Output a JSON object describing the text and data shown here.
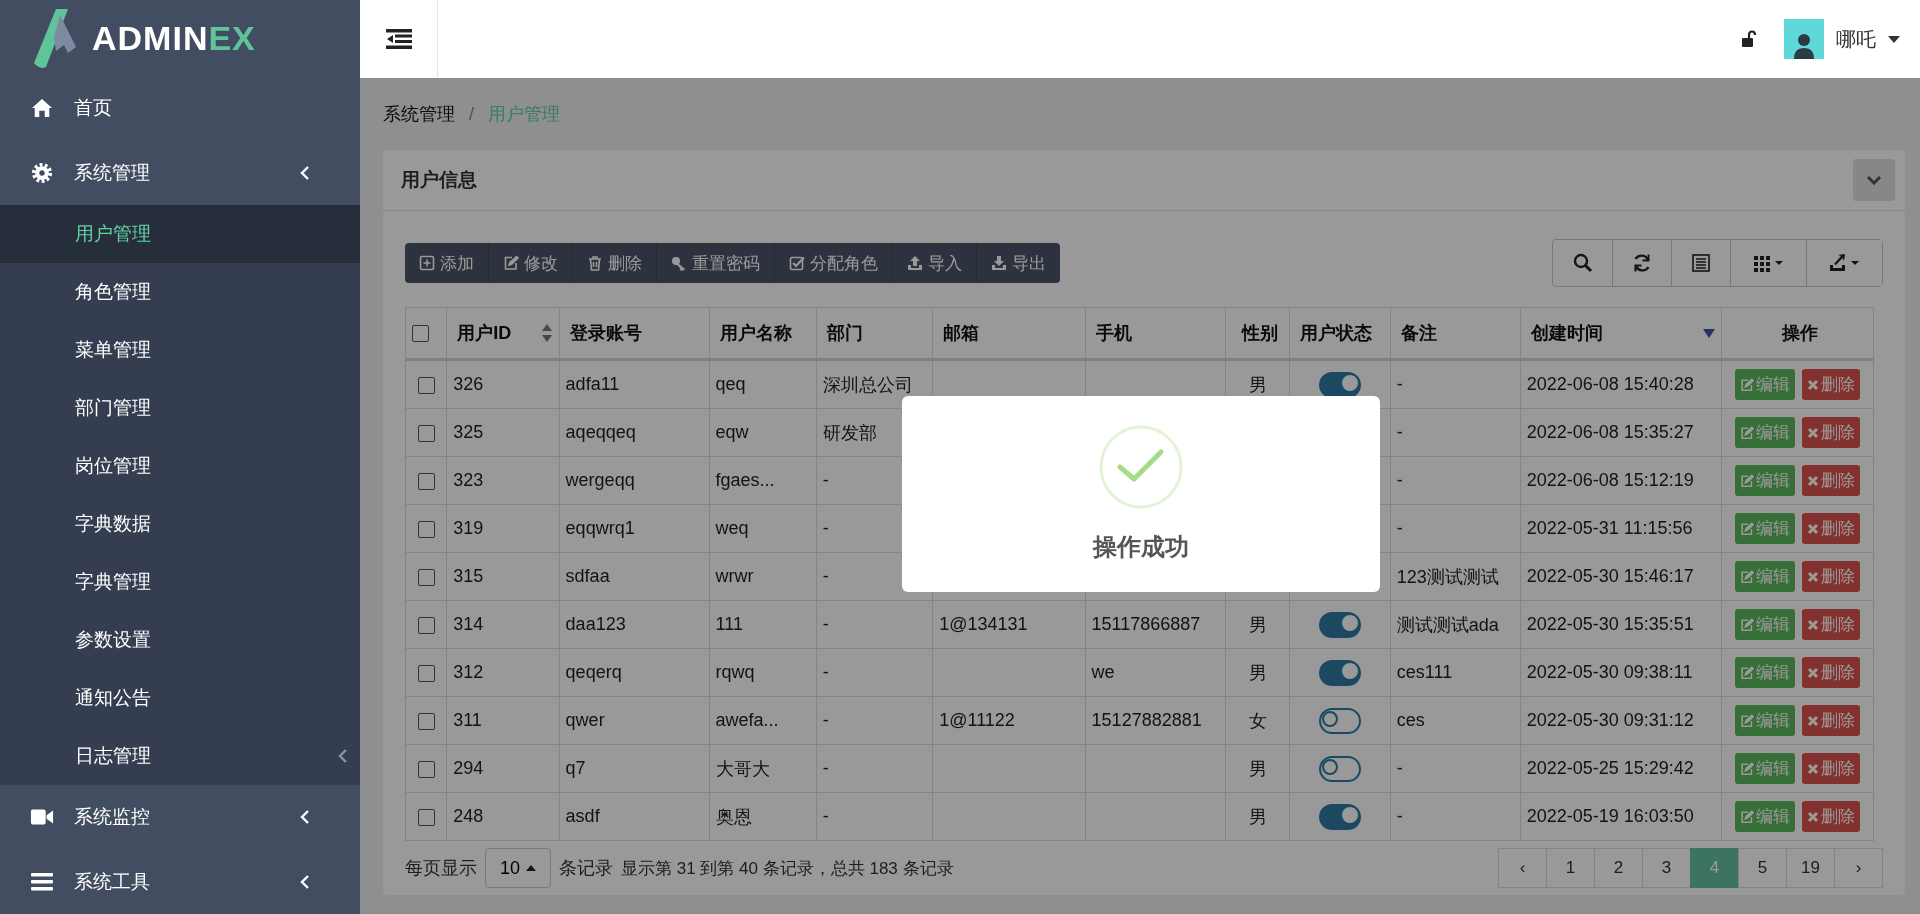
{
  "sidebar": {
    "logo": {
      "text": "ADMIN",
      "accent": "EX"
    },
    "items": [
      {
        "label": "首页",
        "expanded": false,
        "has_submenu": false
      },
      {
        "label": "系统管理",
        "expanded": true,
        "has_submenu": true,
        "children": [
          {
            "label": "用户管理",
            "selected": true,
            "has_submenu": false
          },
          {
            "label": "角色管理",
            "selected": false,
            "has_submenu": false
          },
          {
            "label": "菜单管理",
            "selected": false,
            "has_submenu": false
          },
          {
            "label": "部门管理",
            "selected": false,
            "has_submenu": false
          },
          {
            "label": "岗位管理",
            "selected": false,
            "has_submenu": false
          },
          {
            "label": "字典数据",
            "selected": false,
            "has_submenu": false
          },
          {
            "label": "字典管理",
            "selected": false,
            "has_submenu": false
          },
          {
            "label": "参数设置",
            "selected": false,
            "has_submenu": false
          },
          {
            "label": "通知公告",
            "selected": false,
            "has_submenu": false
          },
          {
            "label": "日志管理",
            "selected": false,
            "has_submenu": true
          }
        ]
      },
      {
        "label": "系统监控",
        "expanded": false,
        "has_submenu": true
      },
      {
        "label": "系统工具",
        "expanded": false,
        "has_submenu": true
      }
    ]
  },
  "header": {
    "user": {
      "name": "哪吒"
    }
  },
  "breadcrumb": {
    "separator": "/",
    "items": [
      {
        "label": "系统管理",
        "selected": false
      },
      {
        "label": "用户管理",
        "selected": true
      }
    ]
  },
  "panel": {
    "title": "用户信息",
    "toolbar": [
      "添加",
      "修改",
      "删除",
      "重置密码",
      "分配角色",
      "导入",
      "导出"
    ],
    "table": {
      "select_all_checked": false,
      "columns": [
        {
          "label": "用户ID",
          "sortable": true,
          "sorted": false
        },
        {
          "label": "登录账号",
          "sortable": false
        },
        {
          "label": "用户名称",
          "sortable": false
        },
        {
          "label": "部门",
          "sortable": false
        },
        {
          "label": "邮箱",
          "sortable": false
        },
        {
          "label": "手机",
          "sortable": false
        },
        {
          "label": "性别",
          "sortable": false
        },
        {
          "label": "用户状态",
          "sortable": false
        },
        {
          "label": "备注",
          "sortable": false
        },
        {
          "label": "创建时间",
          "sortable": true,
          "sorted": true
        },
        {
          "label": "操作",
          "sortable": false
        }
      ],
      "rows": [
        {
          "checked": false,
          "id": "326",
          "account": "adfa11",
          "name": "qeq",
          "dept": "深圳总公司",
          "gender": "男",
          "on": true,
          "remark": "-",
          "created": "2022-06-08 15:40:28",
          "actions": [
            {
              "kind": "edit",
              "label": "编辑"
            },
            {
              "kind": "delete",
              "label": "删除"
            }
          ]
        },
        {
          "checked": false,
          "id": "325",
          "account": "aqeqqeq",
          "name": "eqw",
          "dept": "研发部",
          "remark": "-",
          "created": "2022-06-08 15:35:27",
          "actions": [
            {
              "kind": "edit",
              "label": "编辑"
            },
            {
              "kind": "delete",
              "label": "删除"
            }
          ]
        },
        {
          "checked": false,
          "id": "323",
          "account": "wergeqq",
          "name": "fgaes...",
          "dept": "-",
          "remark": "-",
          "created": "2022-06-08 15:12:19",
          "actions": [
            {
              "kind": "edit",
              "label": "编辑"
            },
            {
              "kind": "delete",
              "label": "删除"
            }
          ]
        },
        {
          "checked": false,
          "id": "319",
          "account": "eqqwrq1",
          "name": "weq",
          "dept": "-",
          "remark": "-",
          "created": "2022-05-31 11:15:56",
          "actions": [
            {
              "kind": "edit",
              "label": "编辑"
            },
            {
              "kind": "delete",
              "label": "删除"
            }
          ]
        },
        {
          "checked": false,
          "id": "315",
          "account": "sdfaa",
          "name": "wrwr",
          "dept": "-",
          "remark": "123测试测试",
          "created": "2022-05-30 15:46:17",
          "actions": [
            {
              "kind": "edit",
              "label": "编辑"
            },
            {
              "kind": "delete",
              "label": "删除"
            }
          ]
        },
        {
          "checked": false,
          "id": "314",
          "account": "daa123",
          "name": "111",
          "dept": "-",
          "email": "1@134131",
          "phone": "15117866887",
          "gender": "男",
          "on": true,
          "remark": "测试测试ada",
          "created": "2022-05-30 15:35:51",
          "actions": [
            {
              "kind": "edit",
              "label": "编辑"
            },
            {
              "kind": "delete",
              "label": "删除"
            }
          ]
        },
        {
          "checked": false,
          "id": "312",
          "account": "qeqerq",
          "name": "rqwq",
          "dept": "-",
          "phone": "we",
          "gender": "男",
          "on": true,
          "remark": "ces111",
          "created": "2022-05-30 09:38:11",
          "actions": [
            {
              "kind": "edit",
              "label": "编辑"
            },
            {
              "kind": "delete",
              "label": "删除"
            }
          ]
        },
        {
          "checked": false,
          "id": "311",
          "account": "qwer",
          "name": "awefa...",
          "dept": "-",
          "email": "1@11122",
          "phone": "15127882881",
          "gender": "女",
          "on": false,
          "remark": "ces",
          "created": "2022-05-30 09:31:12",
          "actions": [
            {
              "kind": "edit",
              "label": "编辑"
            },
            {
              "kind": "delete",
              "label": "删除"
            }
          ]
        },
        {
          "checked": false,
          "id": "294",
          "account": "q7",
          "name": "大哥大",
          "dept": "-",
          "gender": "男",
          "on": false,
          "remark": "-",
          "created": "2022-05-25 15:29:42",
          "actions": [
            {
              "kind": "edit",
              "label": "编辑"
            },
            {
              "kind": "delete",
              "label": "删除"
            }
          ]
        },
        {
          "checked": false,
          "id": "248",
          "account": "asdf",
          "name": "奥恩",
          "dept": "-",
          "gender": "男",
          "on": true,
          "remark": "-",
          "created": "2022-05-19 16:03:50",
          "actions": [
            {
              "kind": "edit",
              "label": "编辑"
            },
            {
              "kind": "delete",
              "label": "删除"
            }
          ]
        }
      ]
    },
    "pagination": {
      "page_size_label": "每页显示",
      "page_size": "10",
      "records_label": "条记录",
      "summary": "显示第 31 到第 40 条记录，总共 183 条记录",
      "pages": [
        {
          "label": "‹",
          "selected": false
        },
        {
          "label": "1",
          "selected": false
        },
        {
          "label": "2",
          "selected": false
        },
        {
          "label": "3",
          "selected": false
        },
        {
          "label": "4",
          "selected": true
        },
        {
          "label": "5",
          "selected": false
        },
        {
          "label": "19",
          "selected": false
        },
        {
          "label": "›",
          "selected": false
        }
      ]
    }
  },
  "modal": {
    "message": "操作成功"
  }
}
